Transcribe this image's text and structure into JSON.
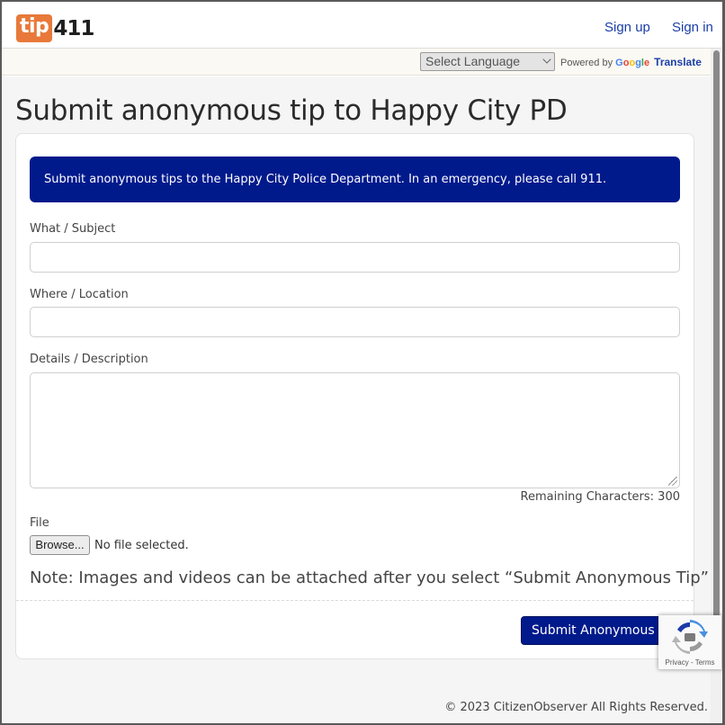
{
  "header": {
    "logo_tip": "tip",
    "logo_num": "411",
    "signup_label": "Sign up",
    "signin_label": "Sign in"
  },
  "translate": {
    "select_label": "Select Language",
    "powered_prefix": "Powered by",
    "google": "Google",
    "translate_link": "Translate"
  },
  "page": {
    "title": "Submit anonymous tip to Happy City PD",
    "banner": "Submit anonymous tips to the Happy City Police Department. In an emergency, please call 911."
  },
  "form": {
    "subject_label": "What / Subject",
    "subject_value": "",
    "location_label": "Where / Location",
    "location_value": "",
    "details_label": "Details / Description",
    "details_value": "",
    "remaining": "Remaining Characters: 300",
    "file_label": "File",
    "browse_label": "Browse...",
    "no_file": "No file selected.",
    "note": "Note: Images and videos can be attached after you select “Submit Anonymous Tip”",
    "submit_label": "Submit Anonymous Tip"
  },
  "recaptcha": {
    "terms": "Privacy - Terms"
  },
  "footer": {
    "copyright": "© 2023 CitizenObserver All Rights Reserved."
  },
  "colors": {
    "brand_orange": "#e8793a",
    "primary_navy": "#001a8c",
    "link_blue": "#1a3ea8",
    "page_bg": "#f5f5f5"
  }
}
